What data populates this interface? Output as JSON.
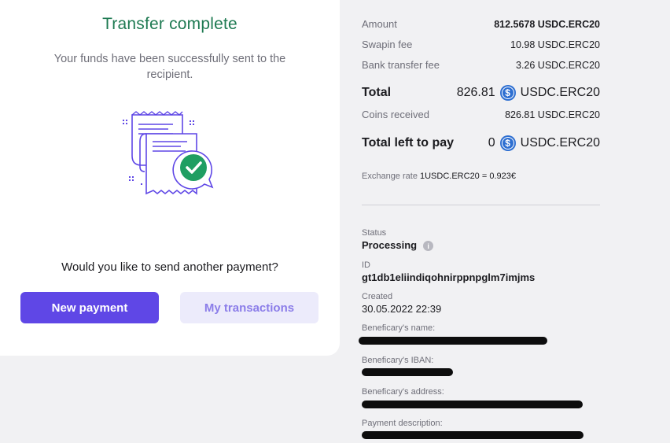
{
  "left": {
    "title": "Transfer complete",
    "subtitle": "Your funds have been successfully sent to the recipient.",
    "illustration_icon": "receipt-check-icon",
    "question": "Would you like to send another payment?",
    "new_payment_label": "New payment",
    "my_transactions_label": "My transactions"
  },
  "summary": {
    "amount_label": "Amount",
    "amount_value": "812.5678 USDC.ERC20",
    "swapin_fee_label": "Swapin fee",
    "swapin_fee_value": "10.98 USDC.ERC20",
    "bank_fee_label": "Bank transfer fee",
    "bank_fee_value": "3.26 USDC.ERC20",
    "total_label": "Total",
    "total_amount": "826.81",
    "total_currency": "USDC.ERC20",
    "coins_received_label": "Coins received",
    "coins_received_value": "826.81 USDC.ERC20",
    "left_to_pay_label": "Total left to pay",
    "left_to_pay_amount": "0",
    "left_to_pay_currency": "USDC.ERC20",
    "exchange_rate_label": "Exchange rate",
    "exchange_rate_value": "1USDC.ERC20 = 0.923€"
  },
  "details": {
    "status_label": "Status",
    "status_value": "Processing",
    "info_glyph": "i",
    "id_label": "ID",
    "id_value": "gt1db1eliindiqohnirppnpglm7imjms",
    "created_label": "Created",
    "created_value": "30.05.2022 22:39",
    "beneficiary_name_label": "Beneficary's name:",
    "beneficiary_iban_label": "Beneficary's IBAN:",
    "beneficiary_address_label": "Beneficary's address:",
    "payment_description_label": "Payment description:"
  },
  "colors": {
    "title_green": "#1e7a52",
    "primary_button": "#5f47e6",
    "secondary_button": "#ecebfb",
    "coin_blue": "#2e6fd1"
  }
}
